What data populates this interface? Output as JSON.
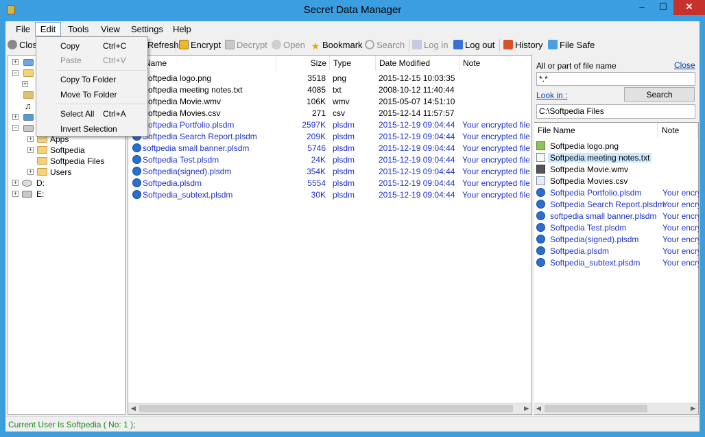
{
  "window": {
    "title": "Secret Data Manager",
    "min": "–",
    "max": "☐",
    "close": "✕"
  },
  "menubar": [
    "File",
    "Edit",
    "Tools",
    "View",
    "Settings",
    "Help"
  ],
  "toolbar": {
    "close": "Close",
    "refresh": "Refresh",
    "encrypt": "Encrypt",
    "decrypt": "Decrypt",
    "open": "Open",
    "bookmark": "Bookmark",
    "search": "Search",
    "login": "Log in",
    "logout": "Log out",
    "history": "History",
    "filesafe": "File Safe"
  },
  "edit_menu": {
    "copy": "Copy",
    "copy_sc": "Ctrl+C",
    "paste": "Paste",
    "paste_sc": "Ctrl+V",
    "copy_to_folder": "Copy To Folder",
    "move_to_folder": "Move To Folder",
    "select_all": "Select All",
    "select_all_sc": "Ctrl+A",
    "invert_selection": "Invert Selection"
  },
  "tree": {
    "apps": "Apps",
    "softpedia": "Softpedia",
    "softpedia_files": "Softpedia Files",
    "users": "Users",
    "drive_d": "D:",
    "drive_e": "E:"
  },
  "filelist": {
    "columns": {
      "name": "Name",
      "size": "Size",
      "type": "Type",
      "date": "Date Modified",
      "note": "Note"
    },
    "rows": [
      {
        "name": "Softpedia logo.png",
        "size": "3518",
        "type": "png",
        "date": "2015-12-15 10:03:35",
        "note": "",
        "icon": "png",
        "encrypted": false
      },
      {
        "name": "Softpedia meeting notes.txt",
        "size": "4085",
        "type": "txt",
        "date": "2008-10-12 11:40:44",
        "note": "",
        "icon": "txt",
        "encrypted": false
      },
      {
        "name": "Softpedia Movie.wmv",
        "size": "106K",
        "type": "wmv",
        "date": "2015-05-07 14:51:10",
        "note": "",
        "icon": "wmv",
        "encrypted": false
      },
      {
        "name": "Softpedia Movies.csv",
        "size": "271",
        "type": "csv",
        "date": "2015-12-14 11:57:57",
        "note": "",
        "icon": "csv",
        "encrypted": false
      },
      {
        "name": "Softpedia Portfolio.plsdm",
        "size": "2597K",
        "type": "plsdm",
        "date": "2015-12-19 09:04:44",
        "note": "Your encrypted file",
        "icon": "plsdm",
        "encrypted": true
      },
      {
        "name": "Softpedia Search Report.plsdm",
        "size": "209K",
        "type": "plsdm",
        "date": "2015-12-19 09:04:44",
        "note": "Your encrypted file",
        "icon": "plsdm",
        "encrypted": true
      },
      {
        "name": "softpedia small banner.plsdm",
        "size": "5746",
        "type": "plsdm",
        "date": "2015-12-19 09:04:44",
        "note": "Your encrypted file",
        "icon": "plsdm",
        "encrypted": true
      },
      {
        "name": "Softpedia Test.plsdm",
        "size": "24K",
        "type": "plsdm",
        "date": "2015-12-19 09:04:44",
        "note": "Your encrypted file",
        "icon": "plsdm",
        "encrypted": true
      },
      {
        "name": "Softpedia(signed).plsdm",
        "size": "354K",
        "type": "plsdm",
        "date": "2015-12-19 09:04:44",
        "note": "Your encrypted file",
        "icon": "plsdm",
        "encrypted": true
      },
      {
        "name": "Softpedia.plsdm",
        "size": "5554",
        "type": "plsdm",
        "date": "2015-12-19 09:04:44",
        "note": "Your encrypted file",
        "icon": "plsdm",
        "encrypted": true
      },
      {
        "name": "Softpedia_subtext.plsdm",
        "size": "30K",
        "type": "plsdm",
        "date": "2015-12-19 09:04:44",
        "note": "Your encrypted file",
        "icon": "plsdm",
        "encrypted": true
      }
    ]
  },
  "search": {
    "label": "All or part of file name",
    "close": "Close",
    "query": "*.*",
    "look_in": "Look in :",
    "button": "Search",
    "path": "C:\\Softpedia Files",
    "columns": {
      "name": "File Name",
      "note": "Note"
    },
    "results": [
      {
        "name": "Softpedia logo.png",
        "note": "",
        "icon": "png",
        "encrypted": false,
        "selected": false
      },
      {
        "name": "Softpedia meeting notes.txt",
        "note": "",
        "icon": "txt",
        "encrypted": false,
        "selected": true
      },
      {
        "name": "Softpedia Movie.wmv",
        "note": "",
        "icon": "wmv",
        "encrypted": false,
        "selected": false
      },
      {
        "name": "Softpedia Movies.csv",
        "note": "",
        "icon": "csv",
        "encrypted": false,
        "selected": false
      },
      {
        "name": "Softpedia Portfolio.plsdm",
        "note": "Your encry",
        "icon": "plsdm",
        "encrypted": true,
        "selected": false
      },
      {
        "name": "Softpedia Search Report.plsdm",
        "note": "Your encry",
        "icon": "plsdm",
        "encrypted": true,
        "selected": false
      },
      {
        "name": "softpedia small banner.plsdm",
        "note": "Your encry",
        "icon": "plsdm",
        "encrypted": true,
        "selected": false
      },
      {
        "name": "Softpedia Test.plsdm",
        "note": "Your encry",
        "icon": "plsdm",
        "encrypted": true,
        "selected": false
      },
      {
        "name": "Softpedia(signed).plsdm",
        "note": "Your encry",
        "icon": "plsdm",
        "encrypted": true,
        "selected": false
      },
      {
        "name": "Softpedia.plsdm",
        "note": "Your encry",
        "icon": "plsdm",
        "encrypted": true,
        "selected": false
      },
      {
        "name": "Softpedia_subtext.plsdm",
        "note": "Your encry",
        "icon": "plsdm",
        "encrypted": true,
        "selected": false
      }
    ]
  },
  "status": "Current User Is Softpedia ( No: 1 );",
  "colors": {
    "titlebar": "#3a9ee0",
    "encrypted_text": "#1e32c8",
    "status_text": "#1a8a1a",
    "selection": "#cce8ff"
  }
}
